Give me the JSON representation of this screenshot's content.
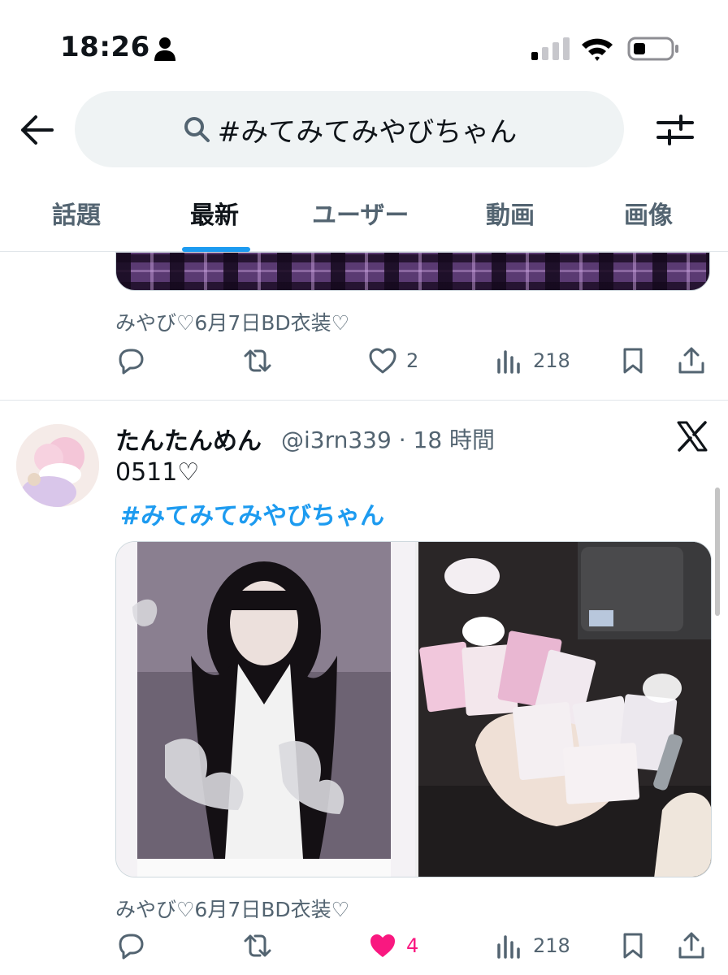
{
  "status_bar": {
    "time": "18:26"
  },
  "search": {
    "query": "#みてみてみやびちゃん"
  },
  "tabs": [
    {
      "label": "話題"
    },
    {
      "label": "最新"
    },
    {
      "label": "ユーザー"
    },
    {
      "label": "動画"
    },
    {
      "label": "画像"
    }
  ],
  "active_tab": "最新",
  "tweet1": {
    "caption": "みやび♡6月7日BD衣装♡",
    "likes": "2",
    "views": "218"
  },
  "tweet2": {
    "name": "たんたんめん",
    "handle_time": "@i3rn339 · 18 時間",
    "text": "0511♡",
    "hashtag": "#みてみてみやびちゃん",
    "caption": "みやび♡6月7日BD衣装♡",
    "likes": "4",
    "views": "218",
    "liked": true
  },
  "colors": {
    "accent": "#1d9bf0",
    "like": "#f91880",
    "muted": "#536471"
  }
}
